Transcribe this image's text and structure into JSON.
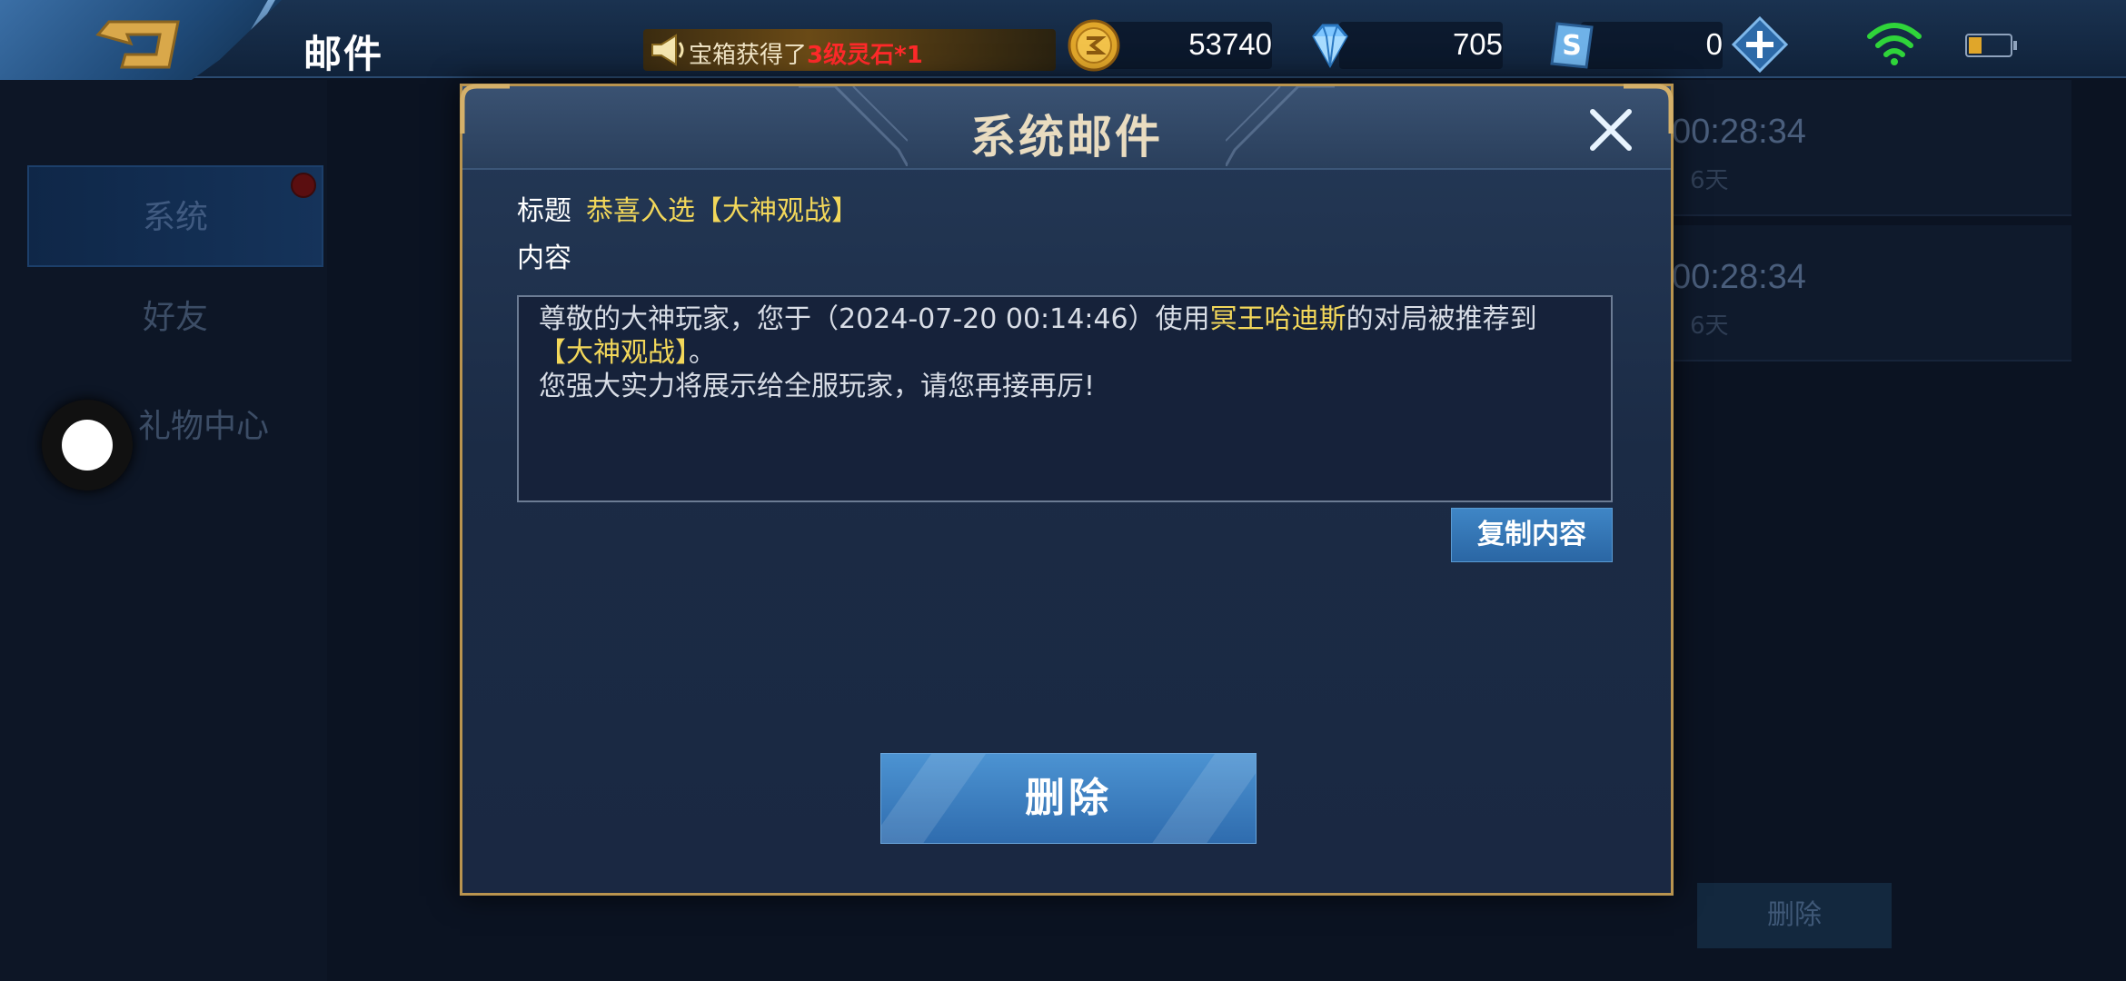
{
  "header": {
    "title": "邮件",
    "back_icon": "back-arrow-icon"
  },
  "marquee": {
    "prefix": "宝箱获得了",
    "highlight": "3级灵石*1",
    "highlight_color": "#ff2a2a"
  },
  "currencies": {
    "gold": {
      "icon": "gold-coin-icon",
      "value": "53740"
    },
    "diamond": {
      "icon": "diamond-icon",
      "value": "705"
    },
    "ticket": {
      "icon": "ticket-icon",
      "value": "0"
    }
  },
  "status": {
    "wifi_icon": "wifi-icon",
    "battery_icon": "battery-icon"
  },
  "sidebar": {
    "items": [
      {
        "label": "系统",
        "active": true,
        "has_badge": true
      },
      {
        "label": "好友",
        "active": false
      },
      {
        "label": "礼物中心",
        "active": false
      }
    ]
  },
  "background_list": {
    "rows": [
      {
        "time": "00:28:34",
        "days": "6天"
      },
      {
        "time": "00:28:34",
        "days": "6天"
      }
    ],
    "delete_label": "删除"
  },
  "modal": {
    "title": "系统邮件",
    "subject_label": "标题",
    "subject_value": "恭喜入选【大神观战】",
    "content_label": "内容",
    "content": {
      "line1_a": "尊敬的大神玩家，您于（2024-07-20 00:14:46）使用",
      "hero": "冥王哈迪斯",
      "line1_b": "的对局被推荐到",
      "event": "【大神观战】",
      "line1_c": "。",
      "line2": "您强大实力将展示给全服玩家，请您再接再厉!"
    },
    "copy_label": "复制内容",
    "delete_label": "删除"
  },
  "colors": {
    "accent_gold": "#f2d75a",
    "frame_gold": "#b9944f",
    "button_blue": "#3f86c6"
  }
}
